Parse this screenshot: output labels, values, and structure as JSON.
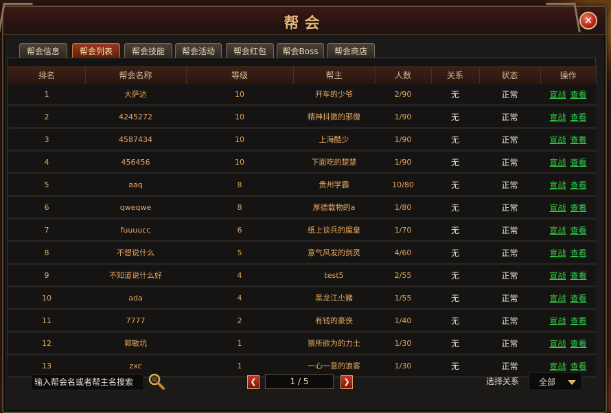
{
  "window": {
    "title": "帮会"
  },
  "tabs": [
    "帮会信息",
    "帮会列表",
    "帮会技能",
    "帮会活动",
    "帮会红包",
    "帮会Boss",
    "帮会商店"
  ],
  "active_tab_index": 1,
  "table": {
    "columns": [
      "排名",
      "帮会名称",
      "等级",
      "帮主",
      "人数",
      "关系",
      "状态",
      "操作"
    ],
    "rows": [
      [
        "1",
        "大萨达",
        "10",
        "开车的少爷",
        "2/90",
        "无",
        "正常"
      ],
      [
        "2",
        "4245272",
        "10",
        "精神抖擞的邪僧",
        "1/90",
        "无",
        "正常"
      ],
      [
        "3",
        "4587434",
        "10",
        "上海酷少",
        "1/90",
        "无",
        "正常"
      ],
      [
        "4",
        "456456",
        "10",
        "下面吃的楚楚",
        "1/90",
        "无",
        "正常"
      ],
      [
        "5",
        "aaq",
        "8",
        "贵州学霸",
        "10/80",
        "无",
        "正常"
      ],
      [
        "6",
        "qweqwe",
        "8",
        "厚德载物的a",
        "1/80",
        "无",
        "正常"
      ],
      [
        "7",
        "fuuuucc",
        "6",
        "纸上谈兵的魔皇",
        "1/70",
        "无",
        "正常"
      ],
      [
        "8",
        "不想说什么",
        "5",
        "意气风发的剑灵",
        "4/60",
        "无",
        "正常"
      ],
      [
        "9",
        "不知道说什么好",
        "4",
        "test5",
        "2/55",
        "无",
        "正常"
      ],
      [
        "10",
        "ada",
        "4",
        "黑龙江尐豬",
        "1/55",
        "无",
        "正常"
      ],
      [
        "11",
        "7777",
        "2",
        "有钱的豪侠",
        "1/40",
        "无",
        "正常"
      ],
      [
        "12",
        "郭敏坑",
        "1",
        "猥所欲为的力士",
        "1/30",
        "无",
        "正常"
      ],
      [
        "13",
        "zxc",
        "1",
        "一心一意的浪客",
        "1/30",
        "无",
        "正常"
      ]
    ],
    "actions": {
      "war": "宣战",
      "view": "查看"
    }
  },
  "search": {
    "placeholder": "输入帮会名或者帮主名搜索"
  },
  "pagination": {
    "current": "1 / 5",
    "prev": "❮",
    "next": "❯"
  },
  "filter": {
    "label": "选择关系",
    "selected": "全部"
  },
  "colors": {
    "accent": "#e8a75e",
    "link": "#2fd23a",
    "active_tab": "#9b3a1c"
  }
}
